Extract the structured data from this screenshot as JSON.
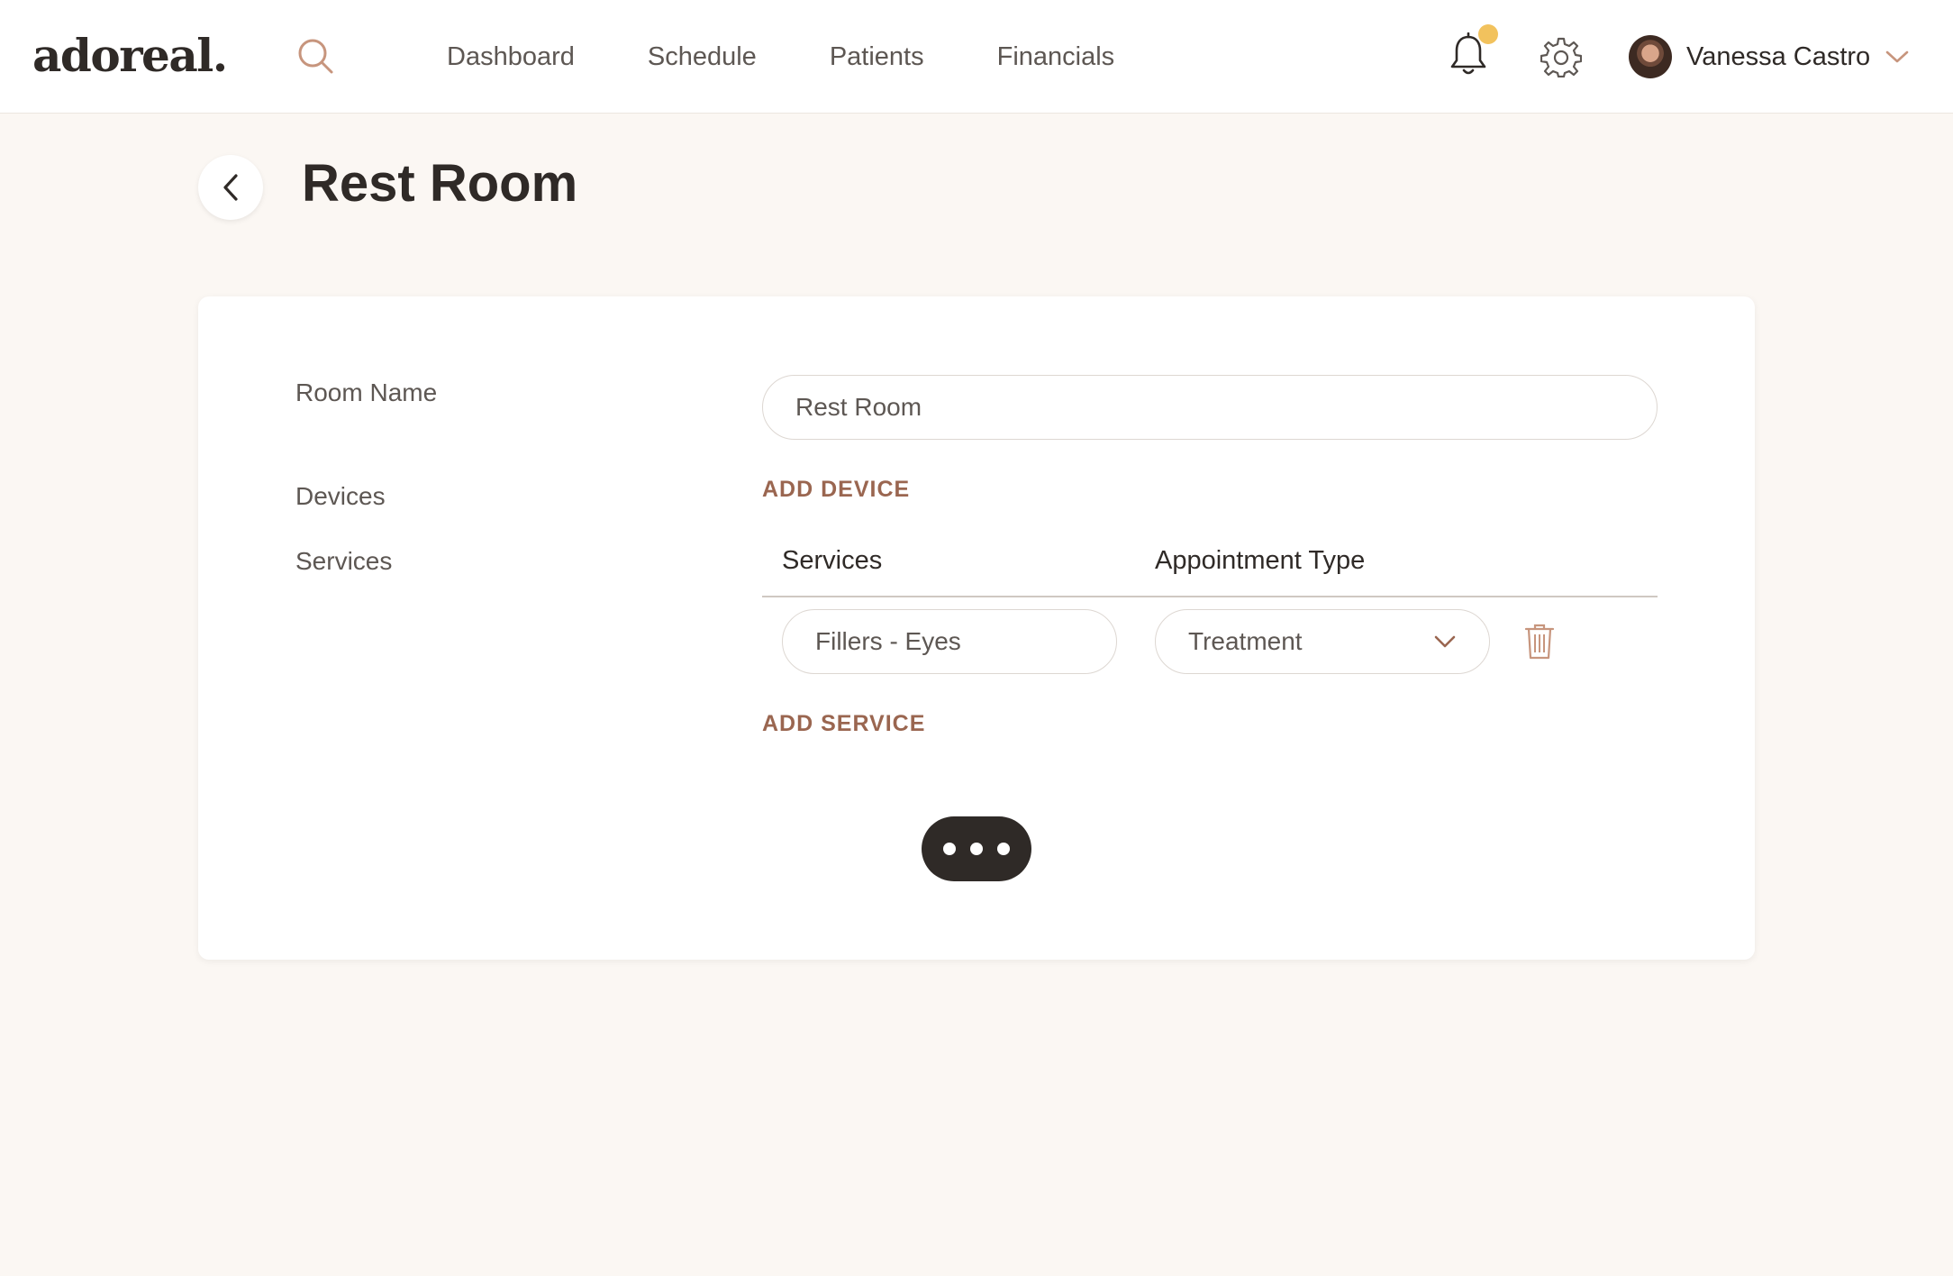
{
  "brand": {
    "logo_text": "adoreal."
  },
  "nav": {
    "links": [
      {
        "label": "Dashboard"
      },
      {
        "label": "Schedule"
      },
      {
        "label": "Patients"
      },
      {
        "label": "Financials"
      }
    ]
  },
  "user": {
    "name": "Vanessa Castro"
  },
  "icons": {
    "search": "search-icon",
    "bell": "bell-icon",
    "settings": "gear-icon",
    "back": "chevron-left-icon",
    "select": "chevron-down-icon",
    "delete": "trash-icon",
    "more": "more-dots-icon"
  },
  "colors": {
    "accent": "#9a6650",
    "notification_dot": "#f2c25d",
    "background": "#fbf7f3",
    "dark_button": "#2f2a27"
  },
  "page": {
    "title": "Rest Room"
  },
  "form": {
    "room_name_label": "Room Name",
    "room_name_value": "Rest Room",
    "devices_label": "Devices",
    "add_device_label": "ADD DEVICE",
    "services_label": "Services",
    "services_table": {
      "headers": [
        "Services",
        "Appointment Type"
      ],
      "rows": [
        {
          "service": "Fillers - Eyes",
          "appointment_type": "Treatment"
        }
      ]
    },
    "add_service_label": "ADD SERVICE"
  }
}
